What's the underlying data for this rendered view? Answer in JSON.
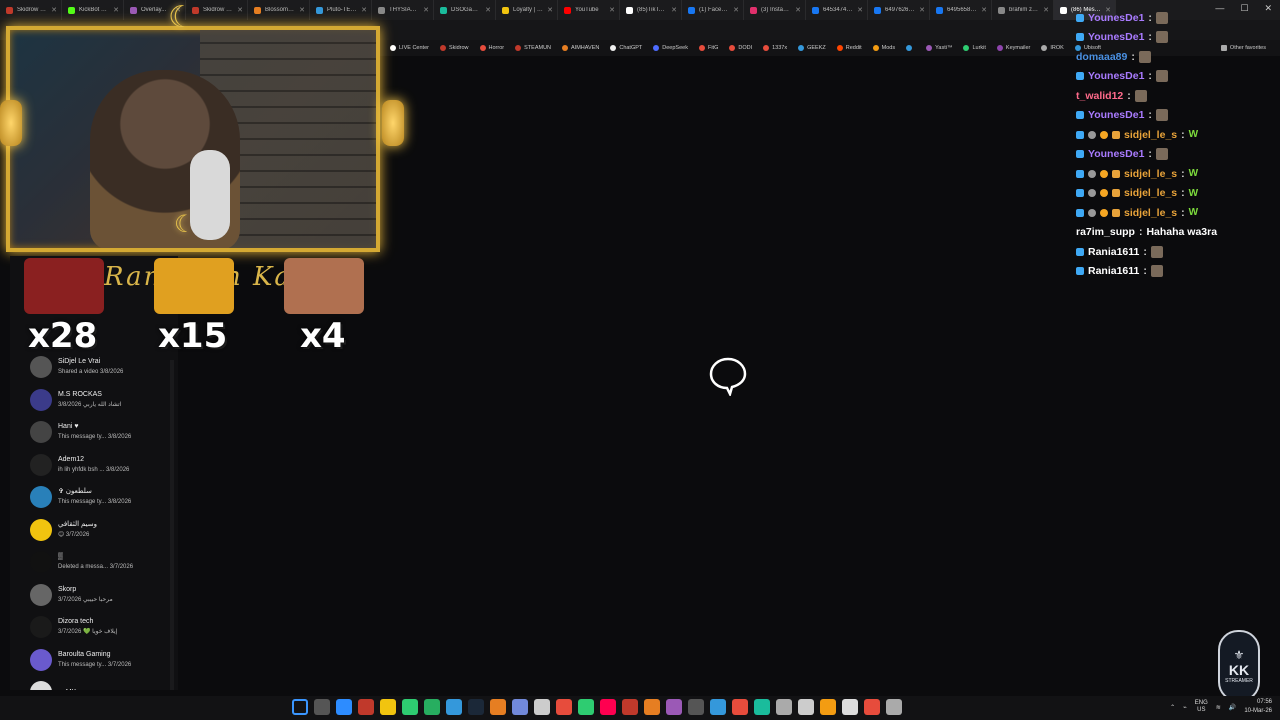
{
  "tabs": [
    {
      "label": "Skidrow & R...",
      "color": "#c0392b"
    },
    {
      "label": "KickBot TTS...",
      "color": "#53fc18"
    },
    {
      "label": "Overlay...",
      "color": "#9b59b6"
    },
    {
      "label": "Skidrow & R...",
      "color": "#c0392b"
    },
    {
      "label": "Blossom Tr...",
      "color": "#e67e22"
    },
    {
      "label": "Pluto-TENO",
      "color": "#3498db"
    },
    {
      "label": "THYSIASTE...",
      "color": "#888888"
    },
    {
      "label": "DSOGaming...",
      "color": "#1abc9c"
    },
    {
      "label": "Loyalty | Bo...",
      "color": "#f1c40f"
    },
    {
      "label": "YouTube",
      "color": "#ff0000"
    },
    {
      "label": "(85)TikTok -",
      "color": "#ffffff"
    },
    {
      "label": "(1) Facebook",
      "color": "#1877f2"
    },
    {
      "label": "(3) Instagram",
      "color": "#e1306c"
    },
    {
      "label": "645347408...",
      "color": "#1877f2"
    },
    {
      "label": "649762640...",
      "color": "#1877f2"
    },
    {
      "label": "649565869...",
      "color": "#1877f2"
    },
    {
      "label": "brahim zel...",
      "color": "#888888"
    },
    {
      "label": "(86) Messe...",
      "color": "#ffffff"
    }
  ],
  "bookmarks": [
    {
      "label": "LIVE Center",
      "color": "#ffffff"
    },
    {
      "label": "Skidrow",
      "color": "#c0392b"
    },
    {
      "label": "Horror",
      "color": "#e74c3c"
    },
    {
      "label": "STEAMUN",
      "color": "#c0392b"
    },
    {
      "label": "AIMHAVEN",
      "color": "#e67e22"
    },
    {
      "label": "ChatGPT",
      "color": "#eeeeee"
    },
    {
      "label": "DeepSeek",
      "color": "#4d6bfe"
    },
    {
      "label": "FitG",
      "color": "#e74c3c"
    },
    {
      "label": "DODI",
      "color": "#e74c3c"
    },
    {
      "label": "1337x",
      "color": "#e74c3c"
    },
    {
      "label": "GEEKZ",
      "color": "#3498db"
    },
    {
      "label": "Reddit",
      "color": "#ff4500"
    },
    {
      "label": "Mods",
      "color": "#f39c12"
    },
    {
      "label": "",
      "color": "#3498db"
    },
    {
      "label": "Yasti™",
      "color": "#9b59b6"
    },
    {
      "label": "Lurkit",
      "color": "#2ecc71"
    },
    {
      "label": "Keymailer",
      "color": "#8e44ad"
    },
    {
      "label": "IROK",
      "color": "#aaaaaa"
    },
    {
      "label": "Ubisoft",
      "color": "#3498db"
    }
  ],
  "other_favorites": "Other favorites",
  "overlay": {
    "banner_text": "Ramadan Kareem",
    "emotes": [
      {
        "count": "x28",
        "color": "#8a2020"
      },
      {
        "count": "x15",
        "color": "#e0a020"
      },
      {
        "count": "x4",
        "color": "#b07050"
      }
    ]
  },
  "conversations": [
    {
      "name": "SiDjel Le Vrai",
      "msg": "Shared a video 3/8/2026",
      "color": "#555"
    },
    {
      "name": "M.S ROCKAS",
      "msg": "اتشاد الله ياربي 3/8/2026",
      "color": "#3b3b8a"
    },
    {
      "name": "Hani ♥",
      "msg": "This message ty... 3/8/2026",
      "color": "#444"
    },
    {
      "name": "Adem12",
      "msg": "ih lih yhfdk bsh ... 3/8/2026",
      "color": "#222"
    },
    {
      "name": "✞ سلطعون",
      "msg": "This message ty... 3/8/2026",
      "color": "#2980b9"
    },
    {
      "name": "وسيم الثقافي",
      "msg": "😊 3/7/2026",
      "color": "#f1c40f"
    },
    {
      "name": "▒",
      "msg": "Deleted a messa... 3/7/2026",
      "color": "#111"
    },
    {
      "name": "Skorp",
      "msg": "مرحبا حبيبي 3/7/2026",
      "color": "#666"
    },
    {
      "name": "Dizora tech",
      "msg": "إيلاف خويا 💚 3/7/2026",
      "color": "#1a1a1a"
    },
    {
      "name": "Baroulta Gaming",
      "msg": "This message ty... 3/7/2026",
      "color": "#6a5acd"
    },
    {
      "name": "euMKeu",
      "msg": "",
      "color": "#ddd"
    }
  ],
  "chat": [
    {
      "user": "YounesDe1",
      "color": "#a97bff",
      "badges": true,
      "msg": ""
    },
    {
      "user": "YounesDe1",
      "color": "#a97bff",
      "badges": true,
      "msg": ""
    },
    {
      "user": "domaaa89",
      "color": "#4a90e2",
      "badges": false,
      "msg": ""
    },
    {
      "user": "YounesDe1",
      "color": "#a97bff",
      "badges": true,
      "msg": ""
    },
    {
      "user": "t_walid12",
      "color": "#ff6b8b",
      "badges": false,
      "msg": ""
    },
    {
      "user": "YounesDe1",
      "color": "#a97bff",
      "badges": true,
      "msg": ""
    },
    {
      "user": "sidjel_le_s",
      "color": "#e8a33a",
      "badges": true,
      "msg": "W"
    },
    {
      "user": "YounesDe1",
      "color": "#a97bff",
      "badges": true,
      "msg": ""
    },
    {
      "user": "sidjel_le_s",
      "color": "#e8a33a",
      "badges": true,
      "msg": "W"
    },
    {
      "user": "sidjel_le_s",
      "color": "#e8a33a",
      "badges": true,
      "msg": "W"
    },
    {
      "user": "sidjel_le_s",
      "color": "#e8a33a",
      "badges": true,
      "msg": "W"
    },
    {
      "user": "ra7im_supp",
      "color": "#ffffff",
      "badges": false,
      "msg": "Hahaha wa3ra"
    },
    {
      "user": "Rania1611",
      "color": "#ffffff",
      "badges": true,
      "msg": ""
    },
    {
      "user": "Rania1611",
      "color": "#ffffff",
      "badges": true,
      "msg": ""
    }
  ],
  "taskbar": {
    "lang": "ENG",
    "region": "US",
    "time": "07:56",
    "date": "10-Mar-26"
  },
  "logo": {
    "text": "KK",
    "sub": "STREAMER"
  }
}
